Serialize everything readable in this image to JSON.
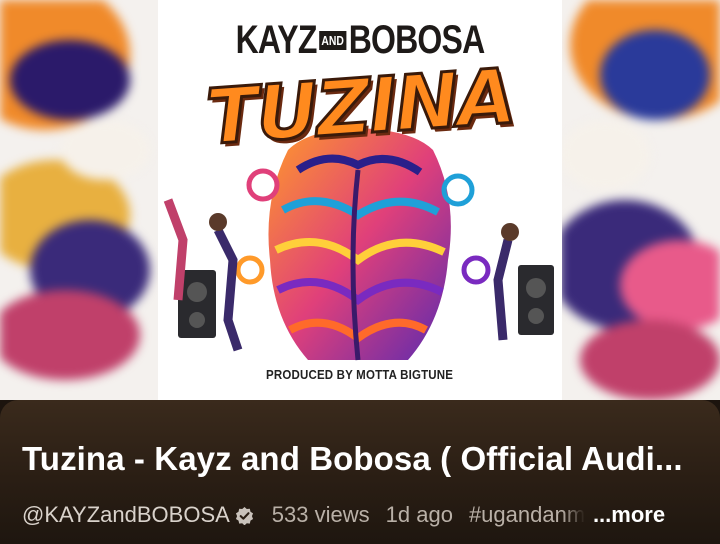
{
  "cover": {
    "artist_left": "KAYZ",
    "artist_and": "AND",
    "artist_right": "BOBOSA",
    "title": "TUZINA",
    "credit": "PRODUCED BY MOTTA BIGTUNE"
  },
  "video": {
    "title": "Tuzina - Kayz and Bobosa ( Official Audi...",
    "channel": "@KAYZandBOBOSA",
    "views": "533 views",
    "age": "1d ago",
    "hashtag": "#ugandanmusic",
    "more_label": "...more"
  },
  "colors": {
    "panel": "#2f2218",
    "title_text": "#ffffff",
    "meta_text": "#b9b0a7",
    "cover_orange": "#ff8a1e"
  },
  "icons": {
    "verified": "verified-check-icon"
  }
}
